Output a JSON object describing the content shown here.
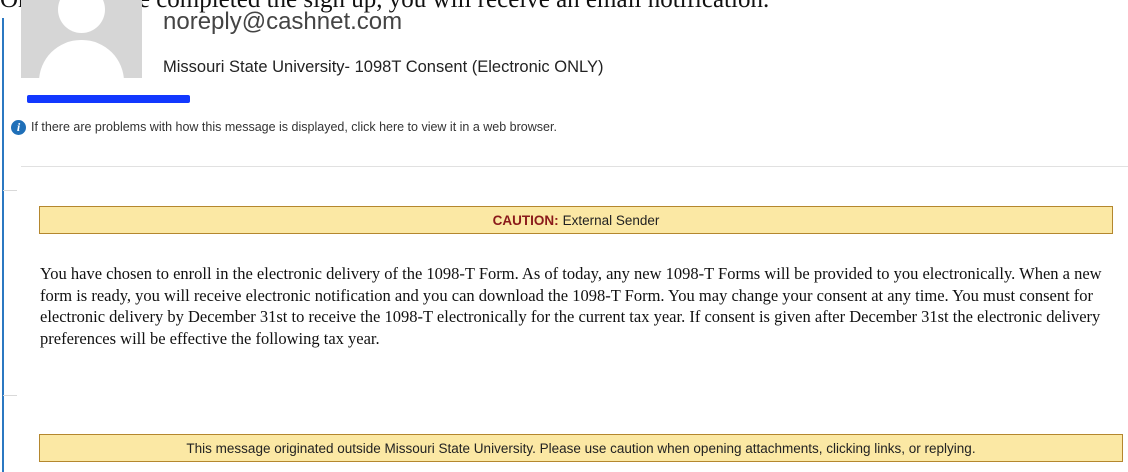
{
  "top_text": "Once you have completed the sign up, you will receive an email notification.",
  "header": {
    "sender_email": "noreply@cashnet.com",
    "subject": "Missouri State University- 1098T Consent (Electronic ONLY)"
  },
  "info_bar": {
    "icon": "info-icon",
    "text": "If there are problems with how this message is displayed, click here to view it in a web browser."
  },
  "caution_banner": {
    "label": "CAUTION:",
    "text": "External Sender"
  },
  "body_text": "You have chosen to enroll in the electronic delivery of the 1098-T Form. As of today, any new 1098-T Forms will be provided to you electronically. When a new form is ready, you will receive electronic notification and you can download the 1098-T Form. You may change your consent at any time. You must consent for electronic delivery by December 31st to receive the 1098-T electronically for the current tax year. If consent is given after December 31st the electronic delivery preferences will be effective the following tax year.",
  "footer_banner": {
    "text": "This message originated outside Missouri State University. Please use caution when opening attachments, clicking links, or replying."
  },
  "colors": {
    "accent_blue": "#1f6fb8",
    "redaction_blue": "#1238ff",
    "banner_fill": "#fbe8a4",
    "banner_border": "#b4872e",
    "caution_red": "#8a1a1a"
  }
}
